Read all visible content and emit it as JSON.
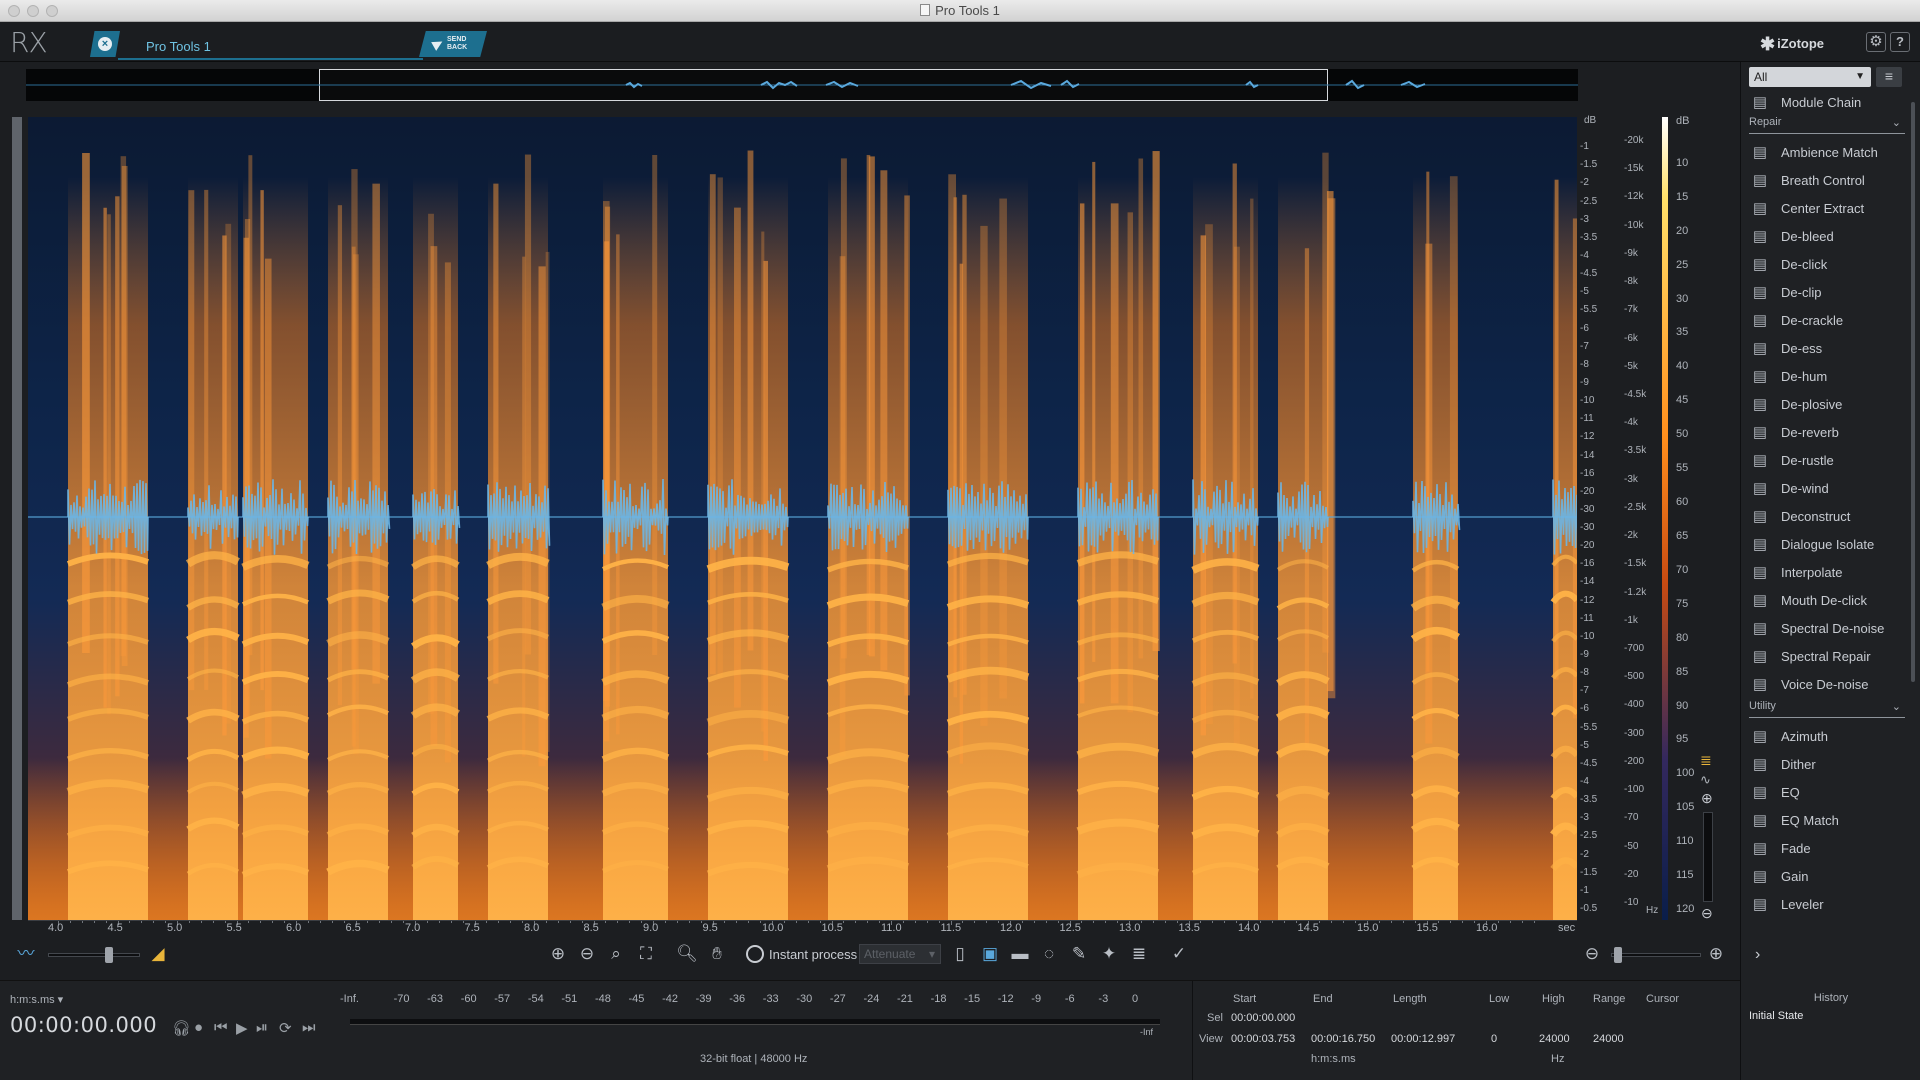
{
  "window": {
    "title": "Pro Tools 1"
  },
  "topbar": {
    "logo": "RX",
    "tab_label": "Pro Tools 1",
    "send_back_label": "SEND BACK",
    "brand": "iZotope",
    "gear_icon": "gear-icon",
    "help_label": "?"
  },
  "db_scale": [
    "dB",
    "-1",
    "-1.5",
    "-2",
    "-2.5",
    "-3",
    "-3.5",
    "-4",
    "-4.5",
    "-5",
    "-5.5",
    "-6",
    "-7",
    "-8",
    "-9",
    "-10",
    "-11",
    "-12",
    "-14",
    "-16",
    "-20",
    "-30",
    "-30",
    "-20",
    "-16",
    "-14",
    "-12",
    "-11",
    "-10",
    "-9",
    "-8",
    "-7",
    "-6",
    "-5.5",
    "-5",
    "-4.5",
    "-4",
    "-3.5",
    "-3",
    "-2.5",
    "-2",
    "-1.5",
    "-1",
    "-0.5"
  ],
  "hz_scale": [
    "-20k",
    "-15k",
    "-12k",
    "-10k",
    "-9k",
    "-8k",
    "-7k",
    "-6k",
    "-5k",
    "-4.5k",
    "-4k",
    "-3.5k",
    "-3k",
    "-2.5k",
    "-2k",
    "-1.5k",
    "-1.2k",
    "-1k",
    "-700",
    "-500",
    "-400",
    "-300",
    "-200",
    "-100",
    "-70",
    "-50",
    "-20",
    "-10",
    "Hz"
  ],
  "colorbar_scale": [
    "dB",
    "10",
    "15",
    "20",
    "25",
    "30",
    "35",
    "40",
    "45",
    "50",
    "55",
    "60",
    "65",
    "70",
    "75",
    "80",
    "85",
    "90",
    "95",
    "100",
    "105",
    "110",
    "115",
    "120"
  ],
  "time_ruler": {
    "labels": [
      "4.0",
      "4.5",
      "5.0",
      "5.5",
      "6.0",
      "6.5",
      "7.0",
      "7.5",
      "8.0",
      "8.5",
      "9.0",
      "9.5",
      "10.0",
      "10.5",
      "11.0",
      "11.5",
      "12.0",
      "12.5",
      "13.0",
      "13.5",
      "14.0",
      "14.5",
      "15.0",
      "15.5",
      "16.0"
    ],
    "unit": "sec"
  },
  "toolbar": {
    "instant_process_label": "Instant process",
    "attenuate_label": "Attenuate",
    "tools": [
      "zoom-in-icon",
      "zoom-out-icon",
      "zoom-selection-icon",
      "zoom-fit-icon",
      "magnify-icon",
      "hand-icon",
      "time-select-icon",
      "freq-select-icon",
      "time-freq-select-icon",
      "lasso-icon",
      "brush-icon",
      "magic-wand-icon",
      "harmonic-icon",
      "pencil-icon"
    ]
  },
  "transport": {
    "time_format": "h:m:s.ms",
    "timecode": "00:00:00.000",
    "icons": [
      "headphones-icon",
      "record-icon",
      "rewind-icon",
      "play-icon",
      "play-selection-icon",
      "loop-icon",
      "skip-end-icon"
    ]
  },
  "meter": {
    "labels": [
      "-Inf.",
      "-70",
      "-63",
      "-60",
      "-57",
      "-54",
      "-51",
      "-48",
      "-45",
      "-42",
      "-39",
      "-36",
      "-33",
      "-30",
      "-27",
      "-24",
      "-21",
      "-18",
      "-15",
      "-12",
      "-9",
      "-6",
      "-3",
      "0"
    ],
    "end_label": "-Inf",
    "format_info": "32-bit float | 48000 Hz"
  },
  "selection": {
    "headers": {
      "start": "Start",
      "end": "End",
      "length": "Length",
      "low": "Low",
      "high": "High",
      "range": "Range",
      "cursor": "Cursor"
    },
    "sel_label": "Sel",
    "view_label": "View",
    "sel_start": "00:00:00.000",
    "view_start": "00:00:03.753",
    "view_end": "00:00:16.750",
    "view_length": "00:00:12.997",
    "low": "0",
    "high": "24000",
    "range": "24000",
    "time_unit": "h:m:s.ms",
    "freq_unit": "Hz"
  },
  "module_panel": {
    "filter": "All",
    "module_chain": "Module Chain",
    "repair_label": "Repair",
    "repair": [
      {
        "label": "Ambience Match",
        "icon": "ambience-match-icon"
      },
      {
        "label": "Breath Control",
        "icon": "breath-control-icon"
      },
      {
        "label": "Center Extract",
        "icon": "center-extract-icon"
      },
      {
        "label": "De-bleed",
        "icon": "de-bleed-icon"
      },
      {
        "label": "De-click",
        "icon": "de-click-icon"
      },
      {
        "label": "De-clip",
        "icon": "de-clip-icon"
      },
      {
        "label": "De-crackle",
        "icon": "de-crackle-icon"
      },
      {
        "label": "De-ess",
        "icon": "de-ess-icon"
      },
      {
        "label": "De-hum",
        "icon": "de-hum-icon"
      },
      {
        "label": "De-plosive",
        "icon": "de-plosive-icon"
      },
      {
        "label": "De-reverb",
        "icon": "de-reverb-icon"
      },
      {
        "label": "De-rustle",
        "icon": "de-rustle-icon"
      },
      {
        "label": "De-wind",
        "icon": "de-wind-icon"
      },
      {
        "label": "Deconstruct",
        "icon": "deconstruct-icon"
      },
      {
        "label": "Dialogue Isolate",
        "icon": "dialogue-isolate-icon"
      },
      {
        "label": "Interpolate",
        "icon": "interpolate-icon"
      },
      {
        "label": "Mouth De-click",
        "icon": "mouth-de-click-icon"
      },
      {
        "label": "Spectral De-noise",
        "icon": "spectral-de-noise-icon"
      },
      {
        "label": "Spectral Repair",
        "icon": "spectral-repair-icon"
      },
      {
        "label": "Voice De-noise",
        "icon": "voice-de-noise-icon"
      }
    ],
    "utility_label": "Utility",
    "utility": [
      {
        "label": "Azimuth",
        "icon": "azimuth-icon"
      },
      {
        "label": "Dither",
        "icon": "dither-icon"
      },
      {
        "label": "EQ",
        "icon": "eq-icon"
      },
      {
        "label": "EQ Match",
        "icon": "eq-match-icon"
      },
      {
        "label": "Fade",
        "icon": "fade-icon"
      },
      {
        "label": "Gain",
        "icon": "gain-icon"
      },
      {
        "label": "Leveler",
        "icon": "leveler-icon"
      }
    ]
  },
  "history": {
    "title": "History",
    "state": "Initial State"
  },
  "colors": {
    "accent": "#1d6f8f",
    "waveform": "#5aa8dc",
    "spectro_hot": "#ff8e1c",
    "spectro_cold": "#0a1c3a"
  }
}
